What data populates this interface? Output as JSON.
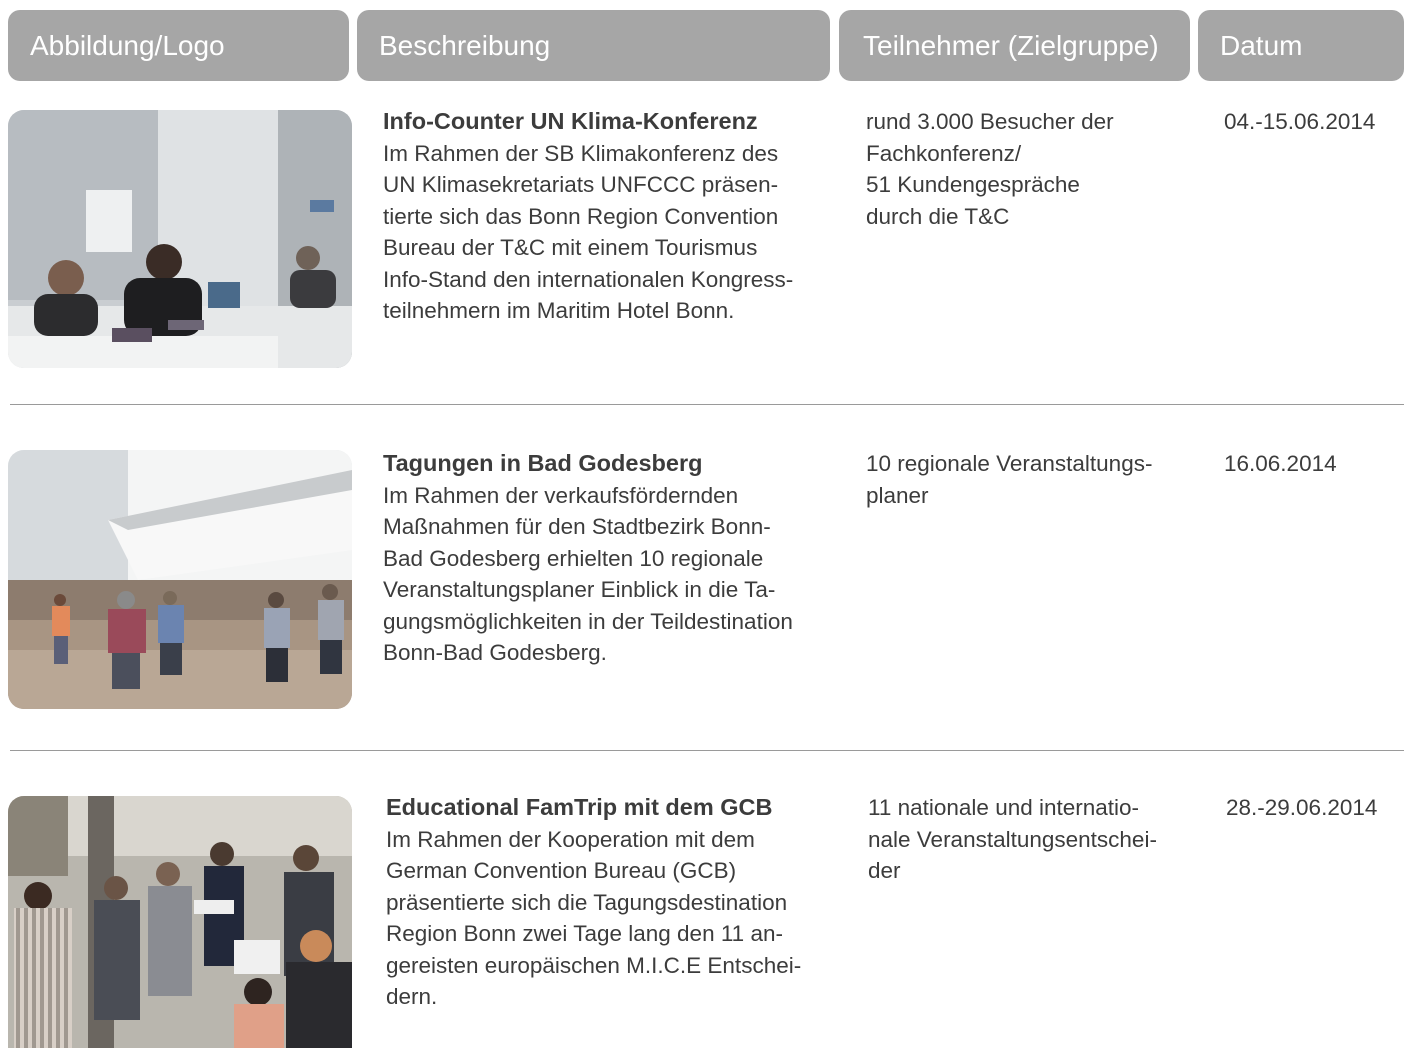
{
  "header": {
    "col1": "Abbildung/Logo",
    "col2": "Beschreibung",
    "col3": "Teilnehmer (Zielgruppe)",
    "col4": "Datum"
  },
  "rows": [
    {
      "title": "Info-Counter UN Klima-Konferenz",
      "description_lines": [
        "Im Rahmen der SB Klimakonferenz des",
        "UN Klimasekretariats UNFCCC präsen-",
        "tierte sich das Bonn Region Convention",
        "Bureau der T&C mit einem Tourismus",
        "Info-Stand den internationalen Kongress-",
        "teilnehmern im Maritim Hotel Bonn."
      ],
      "participants_lines": [
        "rund 3.000 Besucher der",
        "Fachkonferenz/",
        "51 Kundengespräche",
        "durch die T&C"
      ],
      "date": "04.-15.06.2014"
    },
    {
      "title": "Tagungen in Bad Godesberg",
      "description_lines": [
        "Im Rahmen der verkaufsfördernden",
        "Maßnahmen für den Stadtbezirk Bonn-",
        "Bad Godesberg erhielten 10 regionale",
        "Veranstaltungsplaner Einblick in die Ta-",
        "gungsmöglichkeiten in der Teildestination",
        "Bonn-Bad Godesberg."
      ],
      "participants_lines": [
        "10 regionale Veranstaltungs-",
        "planer"
      ],
      "date": "16.06.2014"
    },
    {
      "title": "Educational FamTrip mit dem GCB",
      "description_lines": [
        "Im Rahmen der Kooperation mit dem",
        "German Convention Bureau (GCB)",
        "präsentierte sich die Tagungsdestination",
        "Region Bonn zwei Tage lang den 11 an-",
        "gereisten europäischen M.I.C.E Entschei-",
        "dern."
      ],
      "participants_lines": [
        "11 nationale und internatio-",
        "nale Veranstaltungsentschei-",
        "der"
      ],
      "date": "28.-29.06.2014"
    }
  ],
  "colors": {
    "header_bg": "#a6a6a6",
    "header_text": "#ffffff",
    "body_text": "#3c3c3c",
    "divider": "#9a9a9a"
  }
}
